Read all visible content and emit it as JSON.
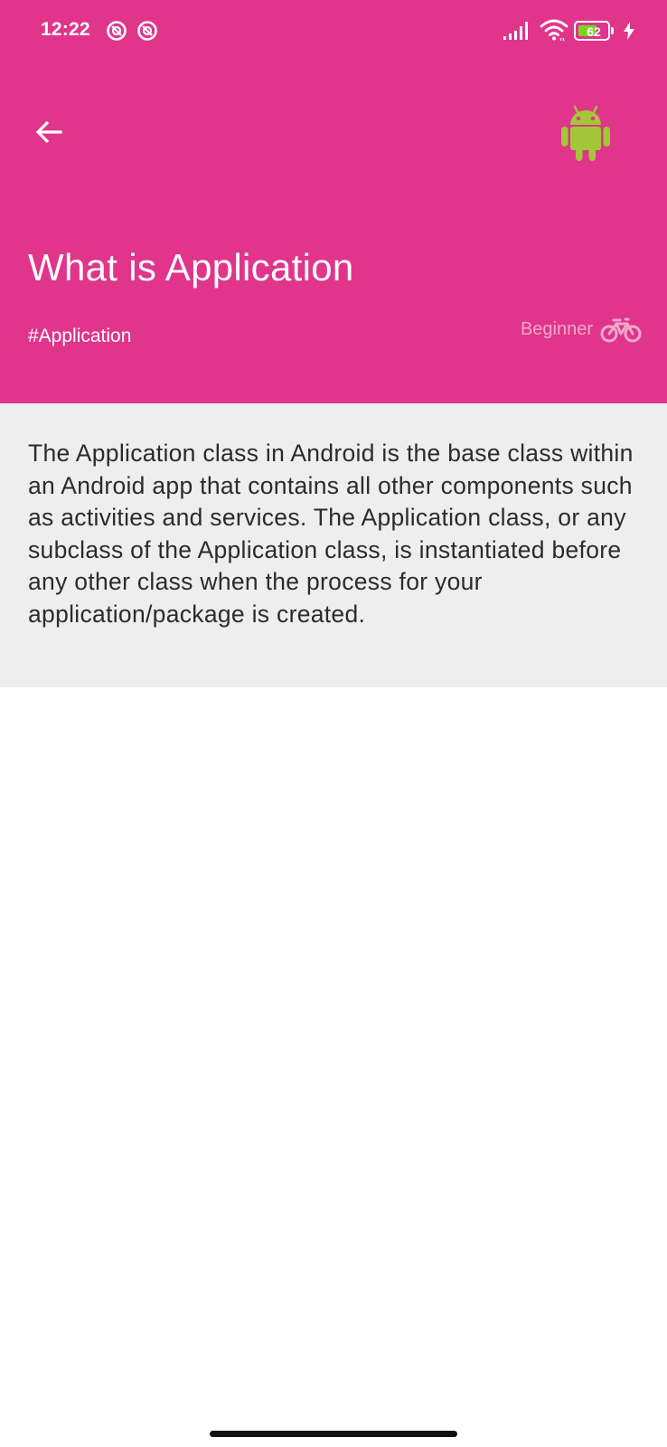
{
  "status_bar": {
    "time": "12:22",
    "battery_level": "62",
    "icons": [
      "notification-icon",
      "notification-icon",
      "signal-icon",
      "wifi-icon",
      "battery-icon",
      "charging-bolt-icon"
    ]
  },
  "app_bar": {
    "back_icon": "arrow-back-icon",
    "brand_icon": "android-icon"
  },
  "header": {
    "title": "What is Application",
    "tag": "#Application",
    "level": "Beginner",
    "level_icon": "bicycle-icon"
  },
  "content": {
    "description": "The Application class in Android is the base class within an Android app that contains all other components such as activities and services. The Application class, or any subclass of the Application class, is instantiated before any other class when the process for your application/package is created."
  },
  "colors": {
    "header_background": "#e0358b",
    "content_background": "#eeeeee",
    "android_green": "#a4c639",
    "level_text": "#f0a8cd",
    "battery_fill": "#7ed321"
  }
}
